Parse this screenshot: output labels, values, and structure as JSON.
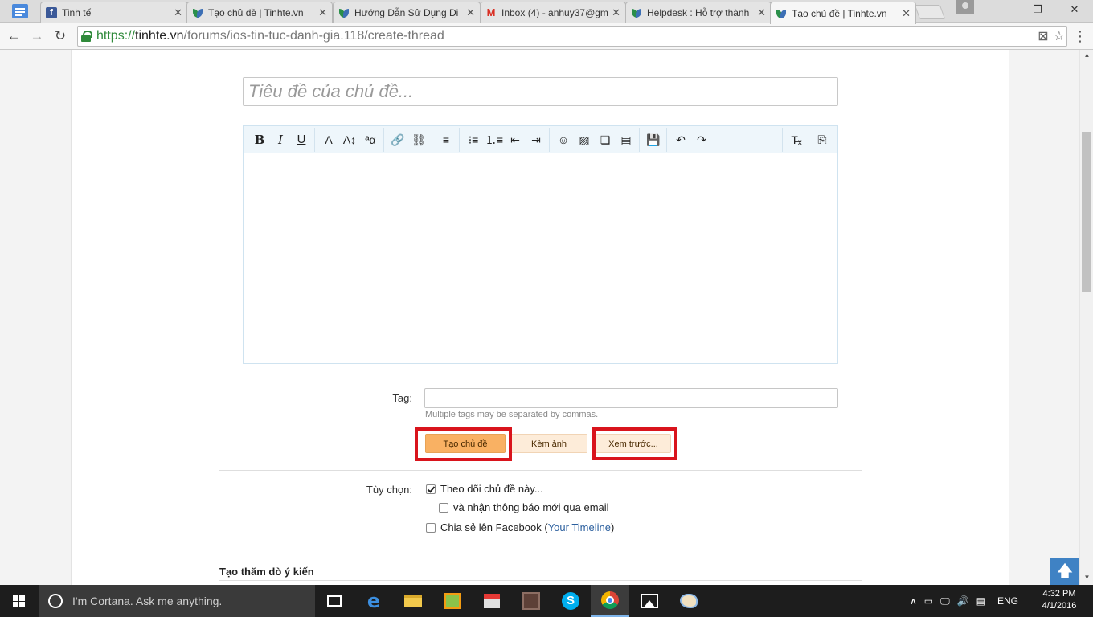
{
  "browser": {
    "tabs": [
      {
        "title": "Tinh tế",
        "favicon": "facebook-icon",
        "active": false
      },
      {
        "title": "Tạo chủ đề | Tinhte.vn",
        "favicon": "tinhte-leaf-icon",
        "active": false
      },
      {
        "title": "Hướng Dẫn Sử Dụng Di",
        "favicon": "tinhte-leaf-icon",
        "active": false
      },
      {
        "title": "Inbox (4) - anhuy37@gm",
        "favicon": "gmail-icon",
        "active": false
      },
      {
        "title": "Helpdesk : Hỗ trợ thành",
        "favicon": "tinhte-leaf-icon",
        "active": false
      },
      {
        "title": "Tạo chủ đề | Tinhte.vn",
        "favicon": "tinhte-leaf-icon",
        "active": true
      }
    ],
    "close_glyph": "✕",
    "url": {
      "scheme": "https://",
      "host": "tinhte.vn",
      "path": "/forums/ios-tin-tuc-danh-gia.118/create-thread"
    },
    "nav": {
      "back": "←",
      "forward": "→",
      "reload": "↻"
    },
    "window": {
      "minimize": "—",
      "maximize": "❐",
      "close": "✕"
    },
    "omni_icons": {
      "translate": "⊠",
      "star": "☆"
    },
    "menu_glyph": "⋮"
  },
  "form": {
    "title_placeholder": "Tiêu đề của chủ đề...",
    "editor_toolbar": [
      {
        "name": "bold-button",
        "glyph": "B",
        "cls": "b"
      },
      {
        "name": "italic-button",
        "glyph": "I",
        "cls": "i"
      },
      {
        "name": "underline-button",
        "glyph": "U",
        "cls": "u"
      },
      {
        "name": "text-color-button",
        "glyph": "A̲",
        "cls": ""
      },
      {
        "name": "font-size-button",
        "glyph": "A↕",
        "cls": ""
      },
      {
        "name": "font-family-button",
        "glyph": "ªα",
        "cls": ""
      },
      {
        "name": "insert-link-button",
        "glyph": "🔗",
        "cls": ""
      },
      {
        "name": "remove-link-button",
        "glyph": "⛓",
        "cls": ""
      },
      {
        "name": "align-button",
        "glyph": "≡",
        "cls": ""
      },
      {
        "name": "bullet-list-button",
        "glyph": "⁝≡",
        "cls": ""
      },
      {
        "name": "numbered-list-button",
        "glyph": "⒈≡",
        "cls": ""
      },
      {
        "name": "outdent-button",
        "glyph": "⇤",
        "cls": ""
      },
      {
        "name": "indent-button",
        "glyph": "⇥",
        "cls": ""
      },
      {
        "name": "smilie-button",
        "glyph": "☺",
        "cls": ""
      },
      {
        "name": "insert-image-button",
        "glyph": "▨",
        "cls": ""
      },
      {
        "name": "insert-media-button",
        "glyph": "❏",
        "cls": ""
      },
      {
        "name": "insert-quote-button",
        "glyph": "▤",
        "cls": ""
      },
      {
        "name": "save-draft-button",
        "glyph": "💾",
        "cls": ""
      },
      {
        "name": "undo-button",
        "glyph": "↶",
        "cls": ""
      },
      {
        "name": "redo-button",
        "glyph": "↷",
        "cls": ""
      },
      {
        "name": "remove-format-button",
        "glyph": "T̶ₓ",
        "cls": ""
      },
      {
        "name": "toggle-bbcode-button",
        "glyph": "⎘",
        "cls": ""
      }
    ],
    "tag_label": "Tag:",
    "tag_hint": "Multiple tags may be separated by commas.",
    "buttons": {
      "create": "Tạo chủ đề",
      "attach": "Kèm ảnh",
      "preview": "Xem trước..."
    },
    "options_label": "Tùy chọn:",
    "options": {
      "watch": {
        "text": "Theo dõi chủ đề này...",
        "checked": true
      },
      "email": {
        "text": "và nhận thông báo mới qua email",
        "checked": false
      },
      "facebook": {
        "text": "Chia sẻ lên Facebook (",
        "link": "Your Timeline",
        "suffix": ")",
        "checked": false
      }
    },
    "poll_heading": "Tạo thăm dò ý kiến",
    "to_top_glyph": "🡅"
  },
  "taskbar": {
    "search_text": "I'm Cortana. Ask me anything.",
    "language": "ENG",
    "time": "4:32 PM",
    "date": "4/1/2016",
    "tray_glyphs": {
      "chevron": "∧",
      "network": "▭",
      "monitor": "🖵",
      "volume": "🔊",
      "message": "▤"
    }
  },
  "colors": {
    "accent_button": "#f9b163",
    "highlight": "#d9141c",
    "link": "#2b5f9e",
    "https": "#2f8a3a"
  }
}
